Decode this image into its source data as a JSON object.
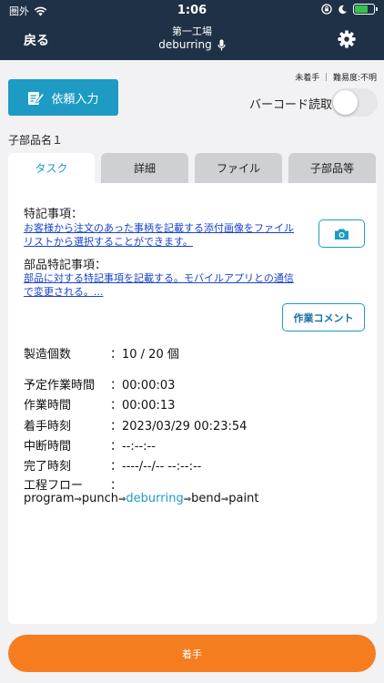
{
  "status_bar": {
    "carrier": "圏外",
    "time": "1:06"
  },
  "nav": {
    "back_label": "戻る",
    "factory": "第一工場",
    "process": "deburring"
  },
  "actions": {
    "request_label": "依頼入力",
    "barcode_label": "バーコード読取",
    "barcode_enabled": false
  },
  "status_info": "未着手 ｜ 難易度:不明",
  "part_name": "子部品名１",
  "tabs": [
    {
      "label": "タスク",
      "active": true
    },
    {
      "label": "詳細",
      "active": false
    },
    {
      "label": "ファイル",
      "active": false
    },
    {
      "label": "子部品等",
      "active": false
    }
  ],
  "task": {
    "special_title": "特記事項：",
    "special_link_line1": "お客様から注文のあった事柄を記載する添付画像をファイル",
    "special_link_line2": "リストから選択することができます。",
    "part_special_title": "部品特記事項：",
    "part_special_link_line1": "部品に対する特記事項を記載する。モバイルアプリとの通信",
    "part_special_link_line2": "で変更される。...",
    "comment_button": "作業コメント",
    "rows": [
      {
        "label": "製造個数",
        "value": "：10 / 20 個"
      },
      {
        "label": "予定作業時間",
        "value": "：00:00:03"
      },
      {
        "label": "作業時間",
        "value": "：00:00:13"
      },
      {
        "label": "着手時刻",
        "value": "：2023/03/29 00:23:54"
      },
      {
        "label": "中断時間",
        "value": "：--:--:--"
      },
      {
        "label": "完了時刻",
        "value": "：----/--/-- --:--:--"
      },
      {
        "label": "工程フロー",
        "value": "："
      }
    ],
    "flow": [
      {
        "name": "program",
        "current": false
      },
      {
        "name": "punch",
        "current": false
      },
      {
        "name": "deburring",
        "current": true
      },
      {
        "name": "bend",
        "current": false
      },
      {
        "name": "paint",
        "current": false
      }
    ],
    "flow_arrow": "⇒"
  },
  "start_button": "着手",
  "colors": {
    "header": "#1e3147",
    "accent": "#1d9bc4",
    "start": "#f57c1f",
    "link": "#1a44c8"
  },
  "icons": [
    "wifi-icon",
    "lock-rotation-icon",
    "moon-icon",
    "battery-icon",
    "microphone-icon",
    "gear-icon",
    "edit-icon",
    "camera-icon"
  ]
}
